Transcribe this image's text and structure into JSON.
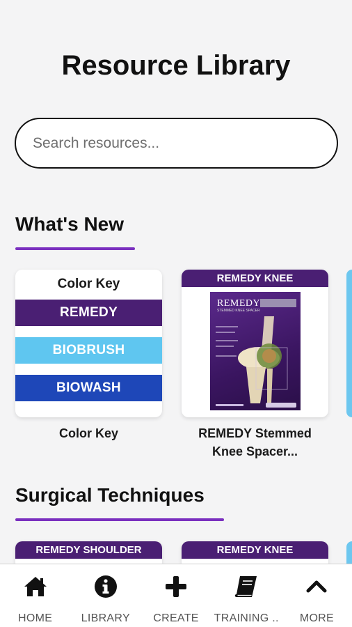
{
  "page": {
    "title": "Resource Library"
  },
  "search": {
    "placeholder": "Search resources..."
  },
  "whats_new": {
    "title": "What's New",
    "cards": [
      {
        "caption": "Color Key",
        "thumb": {
          "heading": "Color Key",
          "bars": [
            {
              "label": "REMEDY",
              "color": "#4a1f73"
            },
            {
              "label": "BIOBRUSH",
              "color": "#5fc6f0"
            },
            {
              "label": "BIOWASH",
              "color": "#1e47b8"
            }
          ]
        }
      },
      {
        "caption": "REMEDY Stemmed Knee Spacer...",
        "thumb": {
          "banner": "REMEDY KNEE",
          "poster_title": "REMEDY",
          "poster_sub": "STEMMED KNEE SPACER"
        }
      }
    ]
  },
  "surgical": {
    "title": "Surgical Techniques",
    "cards": [
      {
        "banner": "REMEDY SHOULDER"
      },
      {
        "banner": "REMEDY KNEE"
      }
    ]
  },
  "nav": {
    "items": [
      {
        "label": "HOME",
        "icon": "home-icon"
      },
      {
        "label": "LIBRARY",
        "icon": "info-icon"
      },
      {
        "label": "CREATE",
        "icon": "plus-icon"
      },
      {
        "label": "TRAINING ..",
        "icon": "book-icon"
      },
      {
        "label": "MORE",
        "icon": "chevron-up-icon"
      }
    ]
  },
  "colors": {
    "accent": "#7a2fbf",
    "remedy": "#4a1f73",
    "biobrush": "#5fc6f0",
    "biowash": "#1e47b8"
  }
}
